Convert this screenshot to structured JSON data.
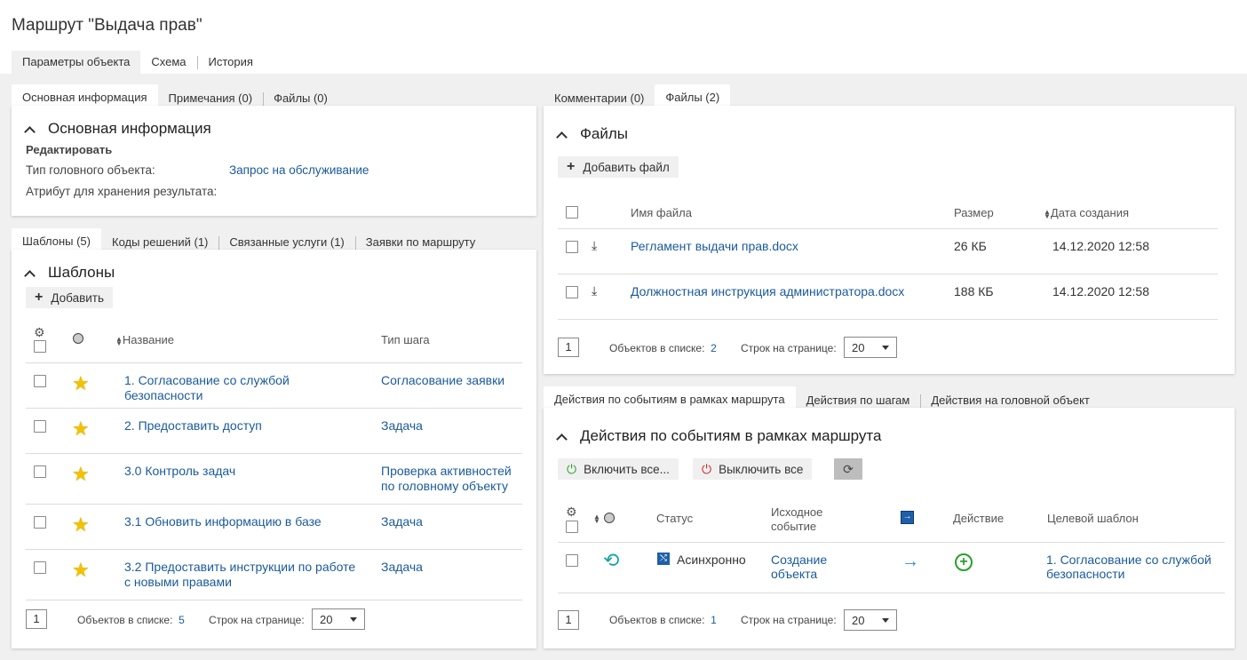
{
  "page_title": "Маршрут \"Выдача прав\"",
  "main_tabs": [
    "Параметры объекта",
    "Схема",
    "История"
  ],
  "left_top": {
    "tabs": [
      "Основная информация",
      "Примечания (0)",
      "Файлы (0)"
    ],
    "section_title": "Основная информация",
    "edit_label": "Редактировать",
    "head_type_label": "Тип головного объекта:",
    "head_type_value": "Запрос на обслуживание",
    "result_attr_label": "Атрибут для хранения результата:"
  },
  "templates": {
    "tabs": [
      "Шаблоны (5)",
      "Коды решений (1)",
      "Связанные услуги (1)",
      "Заявки по маршруту"
    ],
    "section_title": "Шаблоны",
    "add_label": "Добавить",
    "col_name": "Название",
    "col_type": "Тип шага",
    "rows": [
      {
        "name": "1. Согласование со службой безопасности",
        "type": "Согласование заявки"
      },
      {
        "name": "2. Предоставить доступ",
        "type": "Задача"
      },
      {
        "name": "3.0 Контроль задач",
        "type": "Проверка активностей по головному объекту"
      },
      {
        "name": "3.1 Обновить информацию в базе",
        "type": "Задача"
      },
      {
        "name": "3.2 Предоставить инструкции по работе с новыми правами",
        "type": "Задача"
      }
    ],
    "page": "1",
    "count_label": "Объектов в списке:",
    "count": "5",
    "rows_label": "Строк на странице:",
    "rows_per_page": "20"
  },
  "files": {
    "tabs": [
      "Комментарии (0)",
      "Файлы (2)"
    ],
    "section_title": "Файлы",
    "add_label": "Добавить файл",
    "col_name": "Имя файла",
    "col_size": "Размер",
    "col_date": "Дата создания",
    "rows": [
      {
        "name": "Регламент выдачи прав.docx",
        "size": "26 КБ",
        "date": "14.12.2020 12:58"
      },
      {
        "name": "Должностная инструкция администратора.docx",
        "size": "188 КБ",
        "date": "14.12.2020 12:58"
      }
    ],
    "page": "1",
    "count_label": "Объектов в списке:",
    "count": "2",
    "rows_label": "Строк на странице:",
    "rows_per_page": "20"
  },
  "actions": {
    "tabs": [
      "Действия по событиям в рамках маршрута",
      "Действия по шагам",
      "Действия на головной объект"
    ],
    "section_title": "Действия по событиям в рамках маршрута",
    "enable_all": "Включить все...",
    "disable_all": "Выключить все",
    "col_status": "Статус",
    "col_event_1": "Исходное",
    "col_event_2": "событие",
    "col_action": "Действие",
    "col_target": "Целевой шаблон",
    "rows": [
      {
        "status": "Асинхронно",
        "event": "Создание объекта",
        "target": "1. Согласование со службой безопасности"
      }
    ],
    "page": "1",
    "count_label": "Объектов в списке:",
    "count": "1",
    "rows_label": "Строк на странице:",
    "rows_per_page": "20"
  },
  "colors": {
    "link": "#1a5a9a",
    "star": "#f2c200",
    "green": "#2aa02a",
    "red": "#d32020",
    "teal": "#1aa3a3",
    "blue_badge": "#1f5fa8",
    "arrow": "#2a8fd6"
  }
}
